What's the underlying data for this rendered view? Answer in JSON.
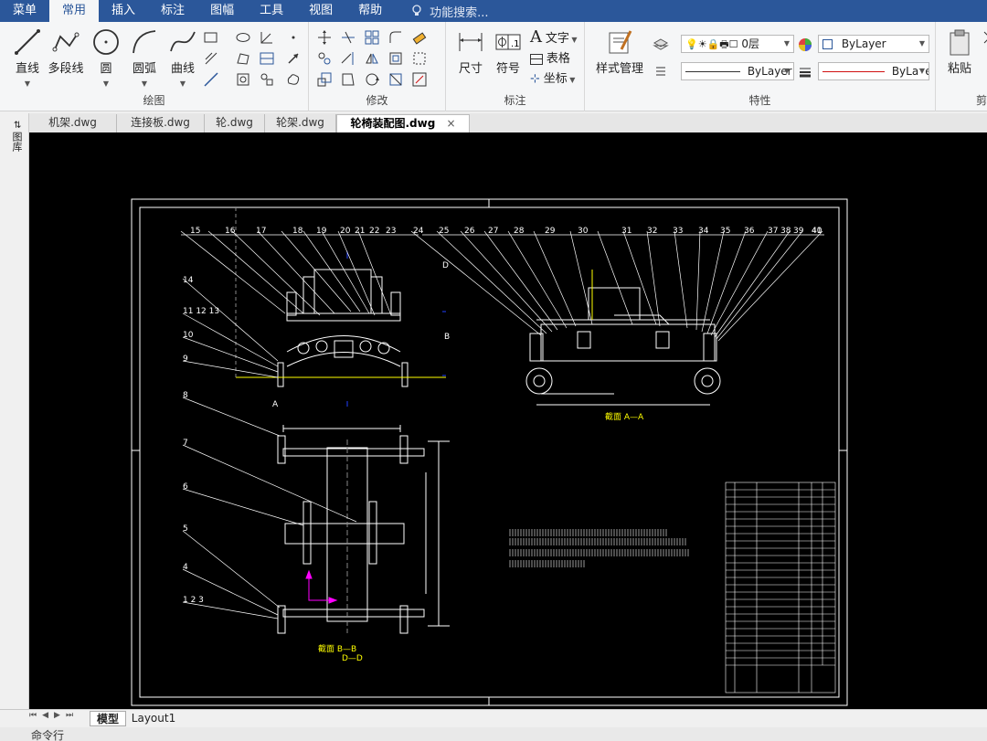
{
  "menubar": {
    "items": [
      "菜单",
      "常用",
      "插入",
      "标注",
      "图幅",
      "工具",
      "视图",
      "帮助"
    ],
    "active_index": 1,
    "search_placeholder": "功能搜索..."
  },
  "ribbon": {
    "draw": {
      "title": "绘图",
      "line": "直线",
      "polyline": "多段线",
      "circle": "圆",
      "arc": "圆弧",
      "curve": "曲线"
    },
    "modify": {
      "title": "修改"
    },
    "annotate": {
      "title": "标注",
      "dimension": "尺寸",
      "symbol": "符号",
      "text": "文字",
      "table": "表格",
      "coordinate": "坐标"
    },
    "properties": {
      "title": "特性",
      "style_manager": "样式管理",
      "layer": "0层",
      "color": "ByLayer",
      "linetype": "ByLayer",
      "lineweight": "ByLayer"
    },
    "clipboard": {
      "paste": "粘贴",
      "title_partial": "剪"
    }
  },
  "doc_tabs": [
    "机架.dwg",
    "连接板.dwg",
    "轮.dwg",
    "轮架.dwg",
    "轮椅装配图.dwg"
  ],
  "active_doc_index": 4,
  "left_strip_label": "图库",
  "drawing": {
    "view_aa_label": "截面   A—A",
    "view_bb_label": "截面   B—B",
    "view_bb_sub": "D—D",
    "section_a": "A",
    "section_b": "B",
    "section_d": "D",
    "balloons_left": [
      "15",
      "16",
      "17",
      "18",
      "19",
      "20",
      "21",
      "22",
      "23"
    ],
    "balloons_right": [
      "24",
      "25",
      "26",
      "27",
      "28",
      "29",
      "30",
      "31",
      "32",
      "33",
      "34",
      "35",
      "36",
      "37",
      "38",
      "39",
      "40",
      "41"
    ],
    "balloons_side": [
      "14",
      "11  12  13",
      "10",
      "9",
      "8",
      "7",
      "6",
      "5",
      "4",
      "1  2  3"
    ]
  },
  "layout_tabs": [
    "模型",
    "Layout1"
  ],
  "active_layout_index": 0,
  "command_line": "命令行",
  "colors": {
    "accent": "#2b579a",
    "canvas": "#000000",
    "draw_white": "#ffffff",
    "draw_yellow": "#ffff00",
    "draw_blue": "#2040ff",
    "draw_magenta": "#ff00ff",
    "property_red": "#d01010"
  }
}
